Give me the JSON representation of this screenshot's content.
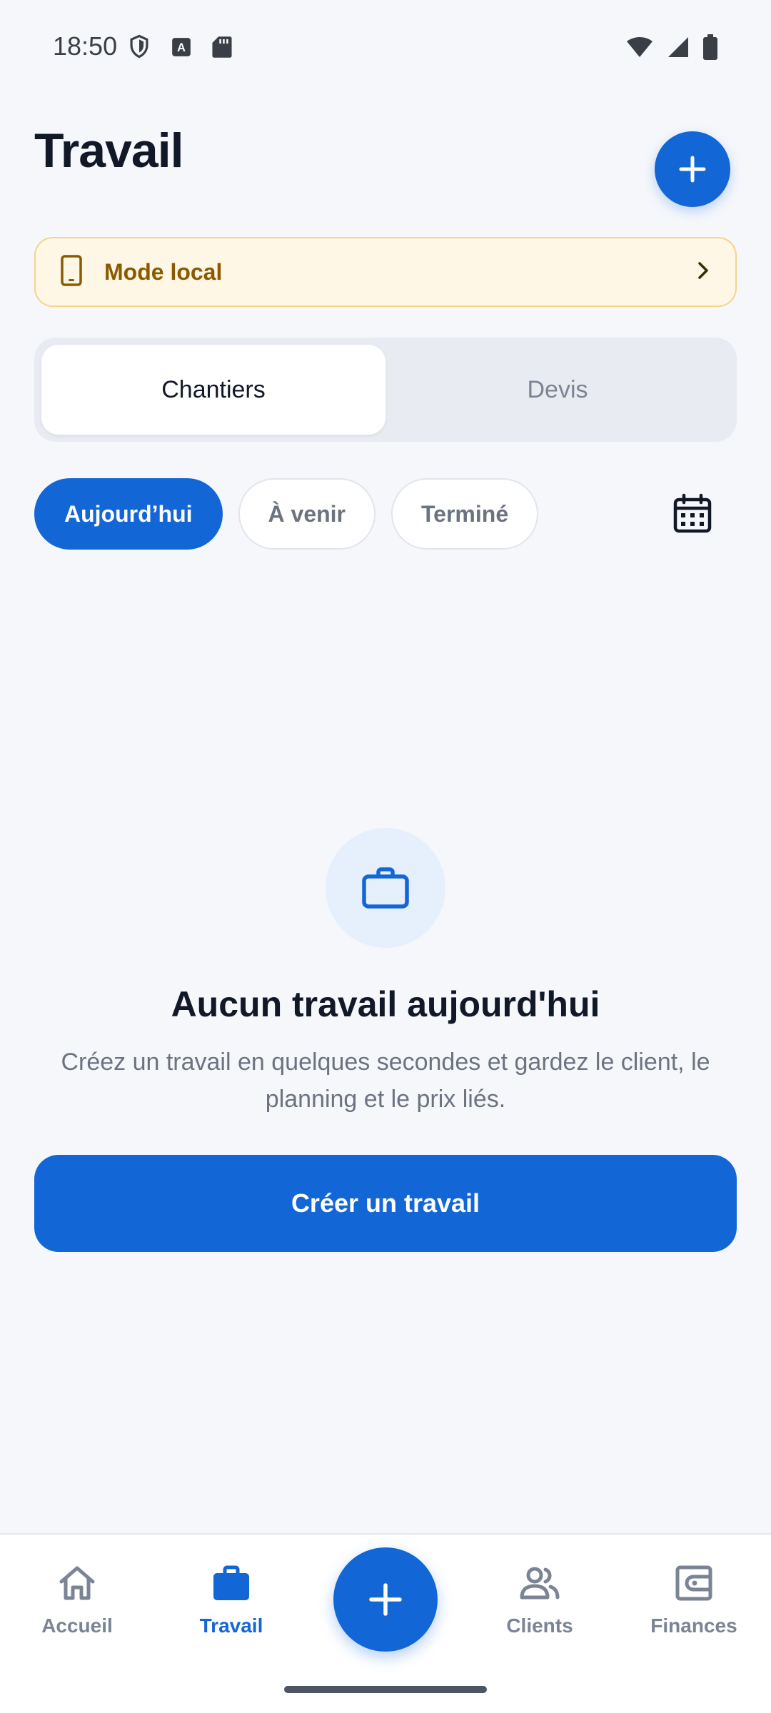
{
  "status_bar": {
    "time": "18:50"
  },
  "header": {
    "title": "Travail"
  },
  "banner": {
    "label": "Mode local"
  },
  "segment": {
    "tabs": [
      {
        "label": "Chantiers",
        "active": true
      },
      {
        "label": "Devis",
        "active": false
      }
    ]
  },
  "filters": {
    "chips": [
      {
        "label": "Aujourd’hui",
        "active": true
      },
      {
        "label": "À venir",
        "active": false
      },
      {
        "label": "Terminé",
        "active": false
      }
    ]
  },
  "empty_state": {
    "title": "Aucun travail aujourd'hui",
    "description": "Créez un travail en quelques secondes et gardez le client, le planning et le prix liés.",
    "button_label": "Créer un travail"
  },
  "bottom_nav": {
    "items": [
      {
        "label": "Accueil",
        "icon": "home-icon",
        "active": false
      },
      {
        "label": "Travail",
        "icon": "briefcase-icon",
        "active": true
      },
      {
        "label": "Clients",
        "icon": "people-icon",
        "active": false
      },
      {
        "label": "Finances",
        "icon": "wallet-icon",
        "active": false
      }
    ]
  },
  "colors": {
    "primary": "#1366d6",
    "banner_bg": "#fff7e6",
    "banner_text": "#8a5a00",
    "background": "#f5f7fb"
  }
}
